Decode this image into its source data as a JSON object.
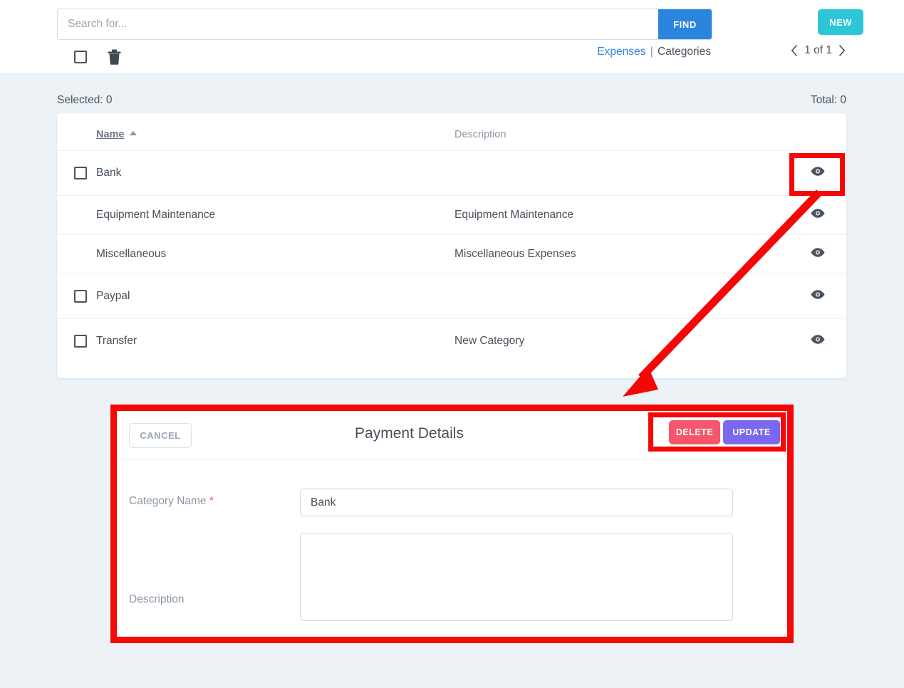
{
  "search": {
    "placeholder": "Search for...",
    "value": "",
    "find_label": "FIND"
  },
  "toolbar": {
    "new_label": "NEW",
    "select_all_icon": "checkbox-icon",
    "delete_icon": "trash-icon"
  },
  "breadcrumb": {
    "link": "Expenses",
    "separator": "|",
    "current": "Categories"
  },
  "pagination": {
    "prev_icon": "chevron-left-icon",
    "next_icon": "chevron-right-icon",
    "label": "1 of 1"
  },
  "list_meta": {
    "selected": "Selected: 0",
    "total": "Total: 0"
  },
  "table": {
    "columns": [
      {
        "key": "checkbox",
        "label": ""
      },
      {
        "key": "name",
        "label": "Name",
        "sorted": "asc"
      },
      {
        "key": "description",
        "label": "Description"
      },
      {
        "key": "view",
        "label": ""
      }
    ],
    "rows": [
      {
        "name": "Bank",
        "description": "",
        "has_checkbox": true,
        "view_icon": "eye-icon",
        "highlighted": true
      },
      {
        "name": "Equipment Maintenance",
        "description": "Equipment Maintenance",
        "has_checkbox": false,
        "view_icon": "eye-icon",
        "highlighted": false
      },
      {
        "name": "Miscellaneous",
        "description": "Miscellaneous Expenses",
        "has_checkbox": false,
        "view_icon": "eye-icon",
        "highlighted": false
      },
      {
        "name": "Paypal",
        "description": "",
        "has_checkbox": true,
        "view_icon": "eye-icon",
        "highlighted": false
      },
      {
        "name": "Transfer",
        "description": "New Category",
        "has_checkbox": true,
        "view_icon": "eye-icon",
        "highlighted": false
      }
    ]
  },
  "detail_panel": {
    "title": "Payment Details",
    "cancel_label": "CANCEL",
    "delete_label": "DELETE",
    "update_label": "UPDATE",
    "fields": {
      "category_name": {
        "label": "Category Name",
        "required_marker": "*",
        "value": "Bank",
        "placeholder": ""
      },
      "description": {
        "label": "Description",
        "value": "",
        "placeholder": ""
      }
    }
  },
  "colors": {
    "page_background": "#ecf2f5",
    "find_button": "#2a85de",
    "new_button": "#2dc6d6",
    "delete_button": "#f5566c",
    "update_button": "#7c68ee",
    "link": "#2a85de",
    "annotation": "#f50707",
    "required": "#f5566c"
  }
}
